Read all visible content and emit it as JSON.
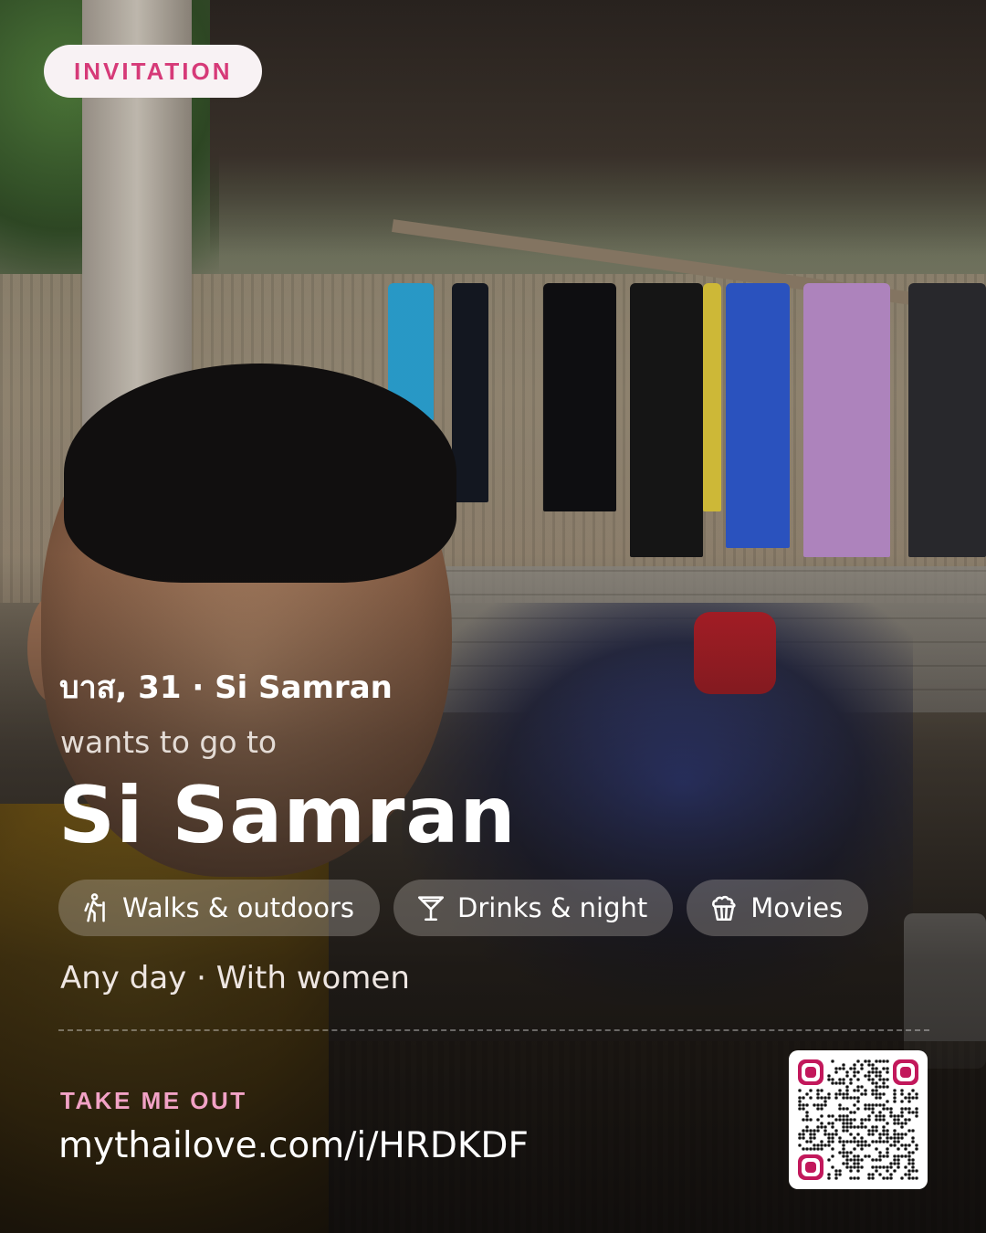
{
  "badge": {
    "label": "INVITATION"
  },
  "profile": {
    "meta": "บาส, 31 · Si Samran",
    "intro": "wants to go to",
    "destination": "Si Samran"
  },
  "interests": [
    {
      "label": "Walks & outdoors",
      "icon": "hiking-icon"
    },
    {
      "label": "Drinks & night",
      "icon": "cocktail-icon"
    },
    {
      "label": "Movies",
      "icon": "popcorn-icon"
    }
  ],
  "availability": "Any day · With women",
  "cta": {
    "label": "TAKE ME OUT",
    "link": "mythailove.com/i/HRDKDF"
  },
  "qr": {
    "icon": "qr-code"
  },
  "colors": {
    "accent": "#d63a78",
    "accent_light": "#f2a2c6",
    "text": "#ffffff",
    "badge_bg": "#f8f2f4"
  }
}
